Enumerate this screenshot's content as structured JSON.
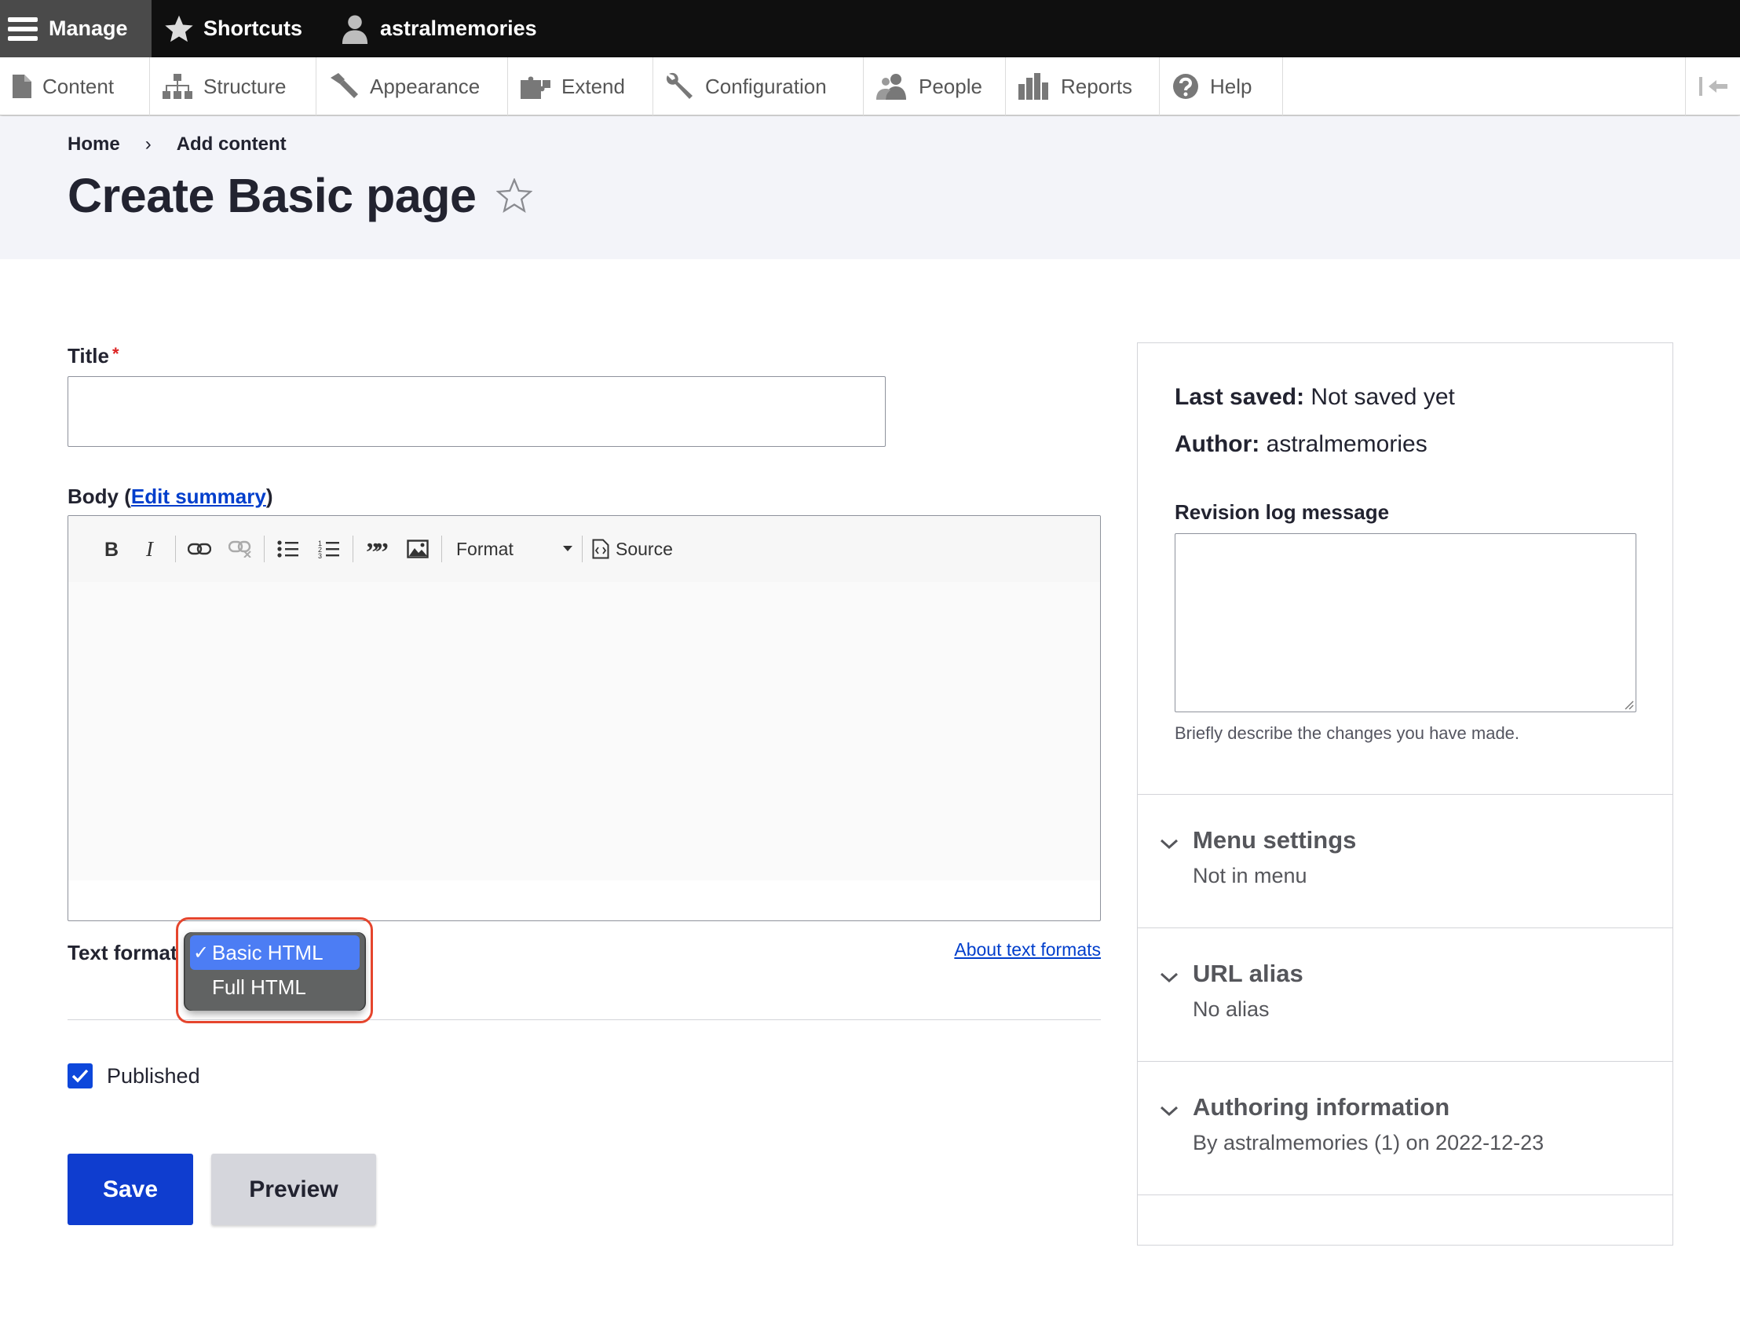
{
  "admin_bar": {
    "manage": "Manage",
    "shortcuts": "Shortcuts",
    "user": "astralmemories"
  },
  "tray": {
    "items": [
      {
        "label": "Content",
        "icon": "file-icon"
      },
      {
        "label": "Structure",
        "icon": "sitemap-icon"
      },
      {
        "label": "Appearance",
        "icon": "hammer-icon"
      },
      {
        "label": "Extend",
        "icon": "puzzle-icon"
      },
      {
        "label": "Configuration",
        "icon": "wrench-icon"
      },
      {
        "label": "People",
        "icon": "people-icon"
      },
      {
        "label": "Reports",
        "icon": "bar-chart-icon"
      },
      {
        "label": "Help",
        "icon": "help-icon"
      }
    ]
  },
  "breadcrumb": {
    "items": [
      "Home",
      "Add content"
    ],
    "separator": "›"
  },
  "page": {
    "title": "Create Basic page"
  },
  "form": {
    "title_label": "Title",
    "required_marker": "*",
    "title_value": "",
    "body_label_prefix": "Body (",
    "edit_summary_link": "Edit summary",
    "body_label_suffix": ")",
    "editor": {
      "format_label": "Format",
      "source_label": "Source",
      "content": ""
    },
    "text_format_label": "Text format",
    "text_format_options": [
      {
        "label": "Basic HTML",
        "selected": true
      },
      {
        "label": "Full HTML",
        "selected": false
      }
    ],
    "check_mark": "✓",
    "about_text_formats": "About text formats",
    "published_label": "Published",
    "published_checked": true,
    "save_button": "Save",
    "preview_button": "Preview"
  },
  "sidebar": {
    "last_saved_label": "Last saved:",
    "last_saved_value": "Not saved yet",
    "author_label": "Author:",
    "author_value": "astralmemories",
    "revision_label": "Revision log message",
    "revision_value": "",
    "revision_description": "Briefly describe the changes you have made.",
    "sections": [
      {
        "title": "Menu settings",
        "summary": "Not in menu"
      },
      {
        "title": "URL alias",
        "summary": "No alias"
      },
      {
        "title": "Authoring information",
        "summary": "By astralmemories (1) on 2022-12-23"
      }
    ]
  },
  "colors": {
    "primary_button": "#0f3dcf",
    "link": "#003ecc",
    "admin_bar": "#0f0f0f",
    "required": "#dc2323",
    "dropdown_selected": "#4c7df4",
    "highlight_outline": "#e5452d"
  }
}
